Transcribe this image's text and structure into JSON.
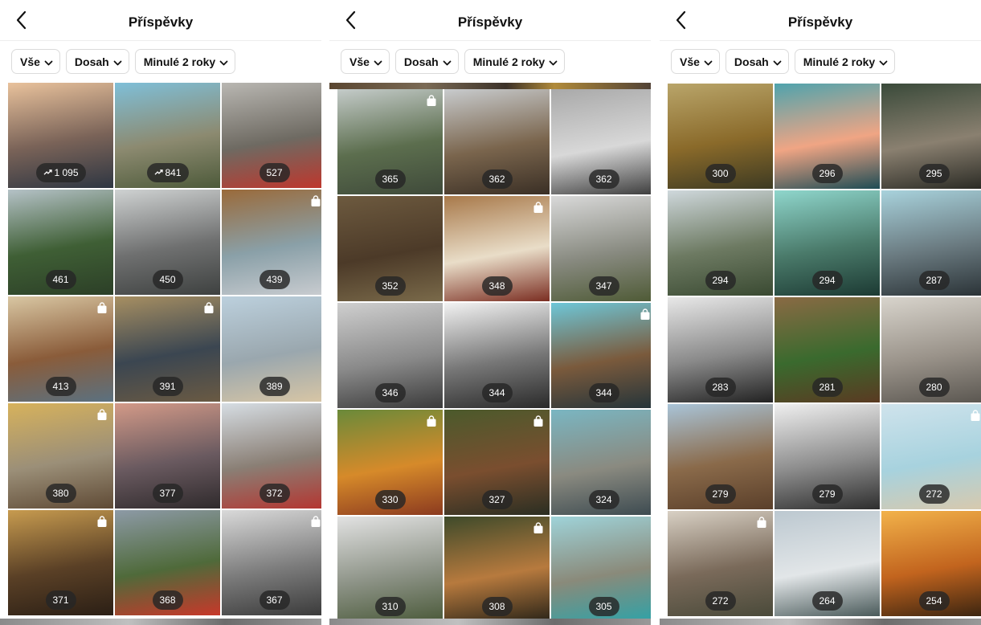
{
  "panels": [
    {
      "title": "Příspěvky",
      "filters": [
        "Vše",
        "Dosah",
        "Minulé 2 roky"
      ],
      "tiles": [
        {
          "value": "1 095",
          "trend": true,
          "bag": false,
          "colors": [
            "#e9c29c",
            "#7a6358",
            "#2e3642"
          ]
        },
        {
          "value": "841",
          "trend": true,
          "bag": false,
          "colors": [
            "#7fbfd8",
            "#8c8a70",
            "#4d5a3a"
          ]
        },
        {
          "value": "527",
          "trend": false,
          "bag": false,
          "colors": [
            "#b9b7b2",
            "#6e6a62",
            "#c0362c"
          ]
        },
        {
          "value": "461",
          "trend": false,
          "bag": false,
          "colors": [
            "#b5c2c7",
            "#3f5f35",
            "#2c3f27"
          ]
        },
        {
          "value": "450",
          "trend": false,
          "bag": false,
          "colors": [
            "#cfd2d2",
            "#6f7070",
            "#3e4140"
          ]
        },
        {
          "value": "439",
          "trend": false,
          "bag": true,
          "colors": [
            "#9a6a3a",
            "#8aa0a8",
            "#c9ccd0"
          ]
        },
        {
          "value": "413",
          "trend": false,
          "bag": true,
          "colors": [
            "#d9c7a3",
            "#8a5c3a",
            "#5b7180"
          ]
        },
        {
          "value": "391",
          "trend": false,
          "bag": true,
          "colors": [
            "#a78f62",
            "#3b4651",
            "#6a5a43"
          ]
        },
        {
          "value": "389",
          "trend": false,
          "bag": false,
          "colors": [
            "#bcd0dd",
            "#9aa7ae",
            "#d8c6a5"
          ]
        },
        {
          "value": "380",
          "trend": false,
          "bag": true,
          "colors": [
            "#d7b25c",
            "#9b8f78",
            "#5f4a35"
          ]
        },
        {
          "value": "377",
          "trend": false,
          "bag": false,
          "colors": [
            "#d39a88",
            "#6a5a60",
            "#2f2a2c"
          ]
        },
        {
          "value": "372",
          "trend": false,
          "bag": false,
          "colors": [
            "#d6dde3",
            "#8a7f75",
            "#b53530"
          ]
        },
        {
          "value": "371",
          "trend": false,
          "bag": true,
          "colors": [
            "#c79b4f",
            "#5a4026",
            "#2b1f15"
          ]
        },
        {
          "value": "368",
          "trend": false,
          "bag": false,
          "colors": [
            "#8d9aa6",
            "#4f6a3a",
            "#c8382a"
          ]
        },
        {
          "value": "367",
          "trend": false,
          "bag": true,
          "colors": [
            "#d9d9d9",
            "#7c7c7c",
            "#3a3a3a"
          ]
        }
      ]
    },
    {
      "title": "Příspěvky",
      "filters": [
        "Vše",
        "Dosah",
        "Minulé 2 roky"
      ],
      "tiles": [
        {
          "value": "365",
          "trend": false,
          "bag": true,
          "colors": [
            "#c4cbc9",
            "#5c6e4e",
            "#3f4a3a"
          ]
        },
        {
          "value": "362",
          "trend": false,
          "bag": false,
          "colors": [
            "#c8cbcd",
            "#7a654d",
            "#3a2f25"
          ]
        },
        {
          "value": "362",
          "trend": false,
          "bag": false,
          "colors": [
            "#a9a9a9",
            "#d8d8d8",
            "#3c3c3c"
          ]
        },
        {
          "value": "352",
          "trend": false,
          "bag": false,
          "colors": [
            "#6d5a3f",
            "#4c3a28",
            "#7a6a4a"
          ]
        },
        {
          "value": "348",
          "trend": false,
          "bag": true,
          "colors": [
            "#a8794a",
            "#e9ddc8",
            "#7b2e22"
          ]
        },
        {
          "value": "347",
          "trend": false,
          "bag": false,
          "colors": [
            "#d9d9d9",
            "#888a80",
            "#4e5a35"
          ]
        },
        {
          "value": "346",
          "trend": false,
          "bag": false,
          "colors": [
            "#cfcfcf",
            "#8a8a8a",
            "#3a3a3a"
          ]
        },
        {
          "value": "344",
          "trend": false,
          "bag": false,
          "colors": [
            "#f2f2f2",
            "#777777",
            "#2a2a2a"
          ]
        },
        {
          "value": "344",
          "trend": false,
          "bag": true,
          "colors": [
            "#6ec7d8",
            "#7a5a3c",
            "#24343a"
          ]
        },
        {
          "value": "330",
          "trend": false,
          "bag": true,
          "colors": [
            "#6a8a3a",
            "#d68a2a",
            "#8b3a1f"
          ]
        },
        {
          "value": "327",
          "trend": false,
          "bag": true,
          "colors": [
            "#4b5a2c",
            "#7a4e2f",
            "#2a2e22"
          ]
        },
        {
          "value": "324",
          "trend": false,
          "bag": false,
          "colors": [
            "#7ab6c2",
            "#8a8a80",
            "#3c4a50"
          ]
        },
        {
          "value": "310",
          "trend": false,
          "bag": false,
          "colors": [
            "#e2e2e2",
            "#8e9488",
            "#4b5a3a"
          ]
        },
        {
          "value": "308",
          "trend": false,
          "bag": true,
          "colors": [
            "#3e4a2a",
            "#b77a3e",
            "#2a2418"
          ]
        },
        {
          "value": "305",
          "trend": false,
          "bag": false,
          "colors": [
            "#9fd3d9",
            "#8a8a7a",
            "#2ea3a8"
          ]
        }
      ]
    },
    {
      "title": "Příspěvky",
      "filters": [
        "Vše",
        "Dosah",
        "Minulé 2 roky"
      ],
      "tiles": [
        {
          "value": "300",
          "trend": false,
          "bag": false,
          "colors": [
            "#b9a56a",
            "#8a6a2a",
            "#3d3a22"
          ]
        },
        {
          "value": "296",
          "trend": false,
          "bag": false,
          "colors": [
            "#4fa3ad",
            "#f0a584",
            "#1e4c55"
          ]
        },
        {
          "value": "295",
          "trend": false,
          "bag": false,
          "colors": [
            "#3a4a3a",
            "#8a8070",
            "#2a2a24"
          ]
        },
        {
          "value": "294",
          "trend": false,
          "bag": false,
          "colors": [
            "#cfd8dc",
            "#6d7a62",
            "#3a4a32"
          ]
        },
        {
          "value": "294",
          "trend": false,
          "bag": false,
          "colors": [
            "#8fd6cc",
            "#4a7a6a",
            "#1c3a33"
          ]
        },
        {
          "value": "287",
          "trend": false,
          "bag": false,
          "colors": [
            "#a8d2dc",
            "#6a7a80",
            "#2a3236"
          ]
        },
        {
          "value": "283",
          "trend": false,
          "bag": false,
          "colors": [
            "#e8e8e8",
            "#8a8a8a",
            "#222222"
          ]
        },
        {
          "value": "281",
          "trend": false,
          "bag": false,
          "colors": [
            "#8a6a44",
            "#3a6a2e",
            "#5a3a22"
          ]
        },
        {
          "value": "280",
          "trend": false,
          "bag": false,
          "colors": [
            "#d8d4cc",
            "#9a938a",
            "#5a5650"
          ]
        },
        {
          "value": "279",
          "trend": false,
          "bag": false,
          "colors": [
            "#a9c4d8",
            "#8a6a4a",
            "#5a3f2a"
          ]
        },
        {
          "value": "279",
          "trend": false,
          "bag": false,
          "colors": [
            "#efefef",
            "#8d8d8d",
            "#2e2e2e"
          ]
        },
        {
          "value": "272",
          "trend": false,
          "bag": true,
          "colors": [
            "#cfe3ec",
            "#a7d2de",
            "#d8c9ad"
          ]
        },
        {
          "value": "272",
          "trend": false,
          "bag": true,
          "colors": [
            "#d8d0c4",
            "#7a6a5a",
            "#4a4a3a"
          ]
        },
        {
          "value": "264",
          "trend": false,
          "bag": false,
          "colors": [
            "#bcc8d0",
            "#e2e6e8",
            "#4a5a5a"
          ]
        },
        {
          "value": "254",
          "trend": false,
          "bag": false,
          "colors": [
            "#f2b24a",
            "#c2641e",
            "#3a2410"
          ]
        }
      ]
    }
  ]
}
